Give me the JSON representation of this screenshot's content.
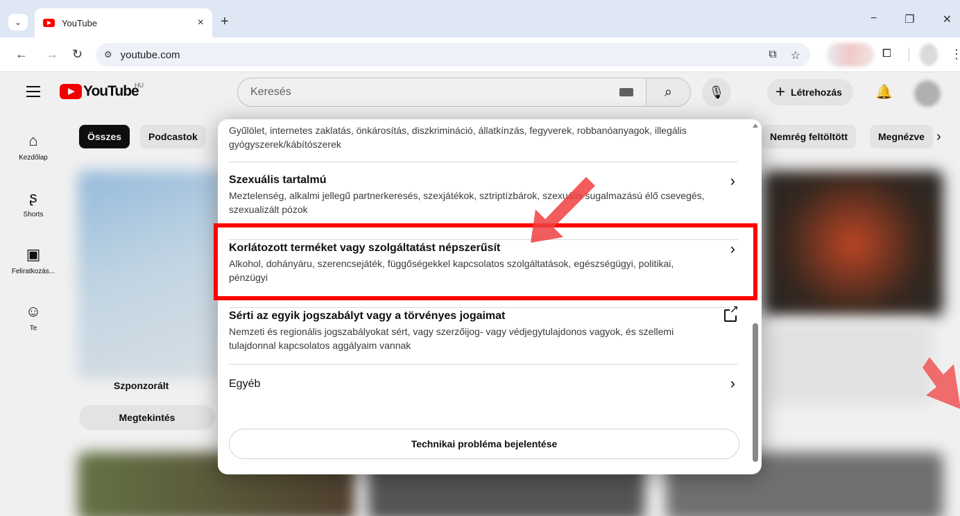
{
  "browser": {
    "tab_title": "YouTube",
    "tab_close": "×",
    "new_tab": "+",
    "url": "youtube.com",
    "window_controls": {
      "minimize": "−",
      "restore": "❐",
      "close": "✕"
    }
  },
  "youtube": {
    "logo_text": "YouTube",
    "country_code": "HU",
    "search_placeholder": "Keresés",
    "create_label": "Létrehozás",
    "sidebar": [
      {
        "icon": "home-icon",
        "label": "Kezdőlap"
      },
      {
        "icon": "shorts-icon",
        "label": "Shorts"
      },
      {
        "icon": "subscriptions-icon",
        "label": "Feliratkozás..."
      },
      {
        "icon": "you-icon",
        "label": "Te"
      }
    ],
    "chips": [
      "Összes",
      "Podcastok",
      "Nemrég feltöltött",
      "Megnézve"
    ],
    "sponsored_label": "Szponzorált",
    "watch_label": "Megtekintés"
  },
  "report_dialog": {
    "partial_option_desc": "Gyűlölet, internetes zaklatás, önkárosítás, diszkrimináció, állatkínzás, fegyverek, robbanóanyagok, illegális gyógyszerek/kábítószerek",
    "options": [
      {
        "title": "Szexuális tartalmú",
        "desc": "Meztelenség, alkalmi jellegű partnerkeresés, szexjátékok, sztriptízbárok, szexuális sugalmazású élő csevegés, szexualizált pózok",
        "action": "chevron"
      },
      {
        "title": "Korlátozott terméket vagy szolgáltatást népszerűsít",
        "desc": "Alkohol, dohányáru, szerencsejáték, függőségekkel kapcsolatos szolgáltatások, egészségügyi, politikai, pénzügyi",
        "action": "chevron",
        "highlighted": true
      },
      {
        "title": "Sérti az egyik jogszabályt vagy a törvényes jogaimat",
        "desc": "Nemzeti és regionális jogszabályokat sért, vagy szerzőijog- vagy védjegytulajdonos vagyok, és szellemi tulajdonnal kapcsolatos aggályaim vannak",
        "action": "external-link"
      },
      {
        "title": "Egyéb",
        "desc": "",
        "action": "chevron"
      }
    ],
    "report_technical_label": "Technikai probléma bejelentése"
  },
  "annotation": {
    "highlight_color": "#ff0000",
    "arrow_color": "#f04040"
  }
}
